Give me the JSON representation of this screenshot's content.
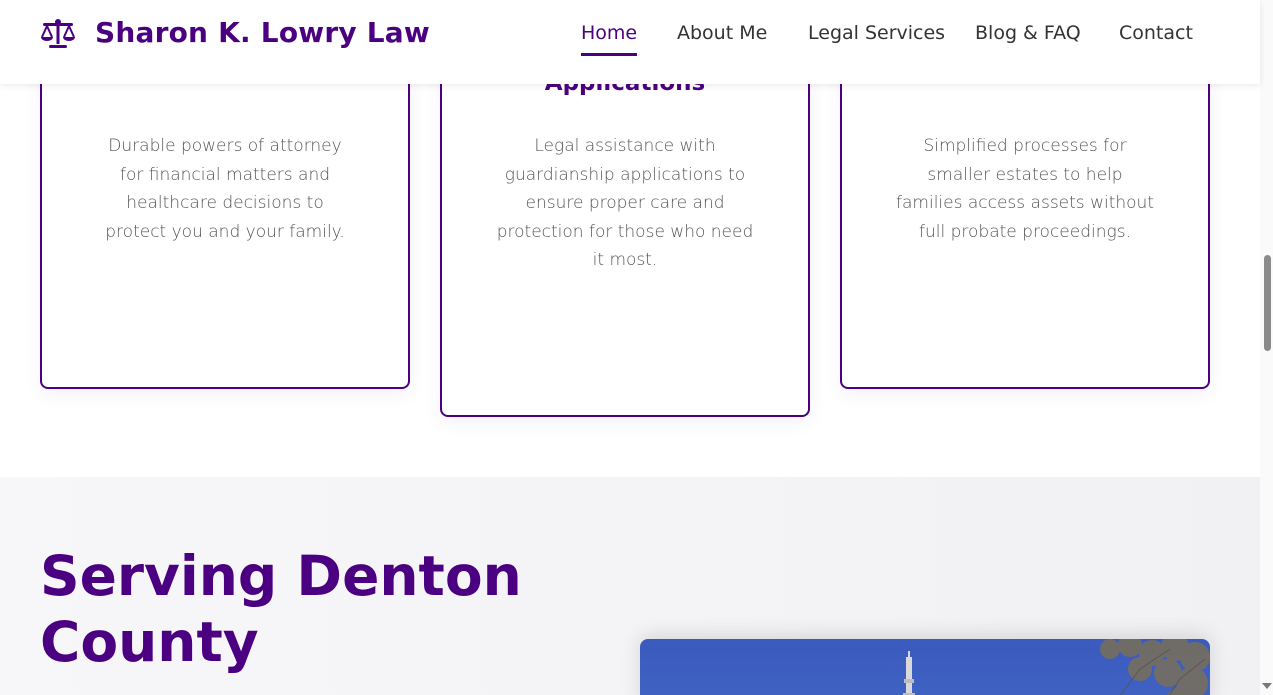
{
  "header": {
    "brand": "Sharon K. Lowry Law",
    "logo_icon": "scales-of-justice-icon",
    "nav": [
      {
        "label": "Home",
        "active": true
      },
      {
        "label": "About Me",
        "active": false
      },
      {
        "label": "Legal Services",
        "active": false
      },
      {
        "label": "Blog & FAQ",
        "active": false
      },
      {
        "label": "Contact",
        "active": false
      }
    ]
  },
  "services": {
    "cards": [
      {
        "title": "",
        "description": "Durable powers of attorney for financial matters and healthcare decisions to protect you and your family."
      },
      {
        "title": "Applications",
        "description": "Legal assistance with guardianship applications to ensure proper care and protection for those who need it most."
      },
      {
        "title": "",
        "description": "Simplified processes for smaller estates to help families access assets without full probate proceedings."
      }
    ]
  },
  "serving": {
    "title": "Serving Denton County"
  },
  "colors": {
    "brand": "#4b0082",
    "text": "#333333",
    "muted": "#555555",
    "sky": "#4063c4"
  }
}
